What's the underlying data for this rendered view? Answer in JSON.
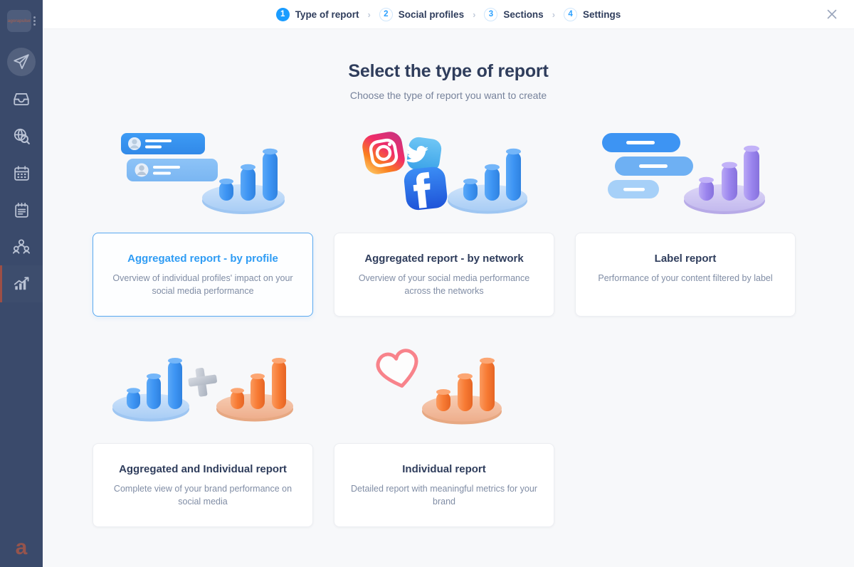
{
  "sidebar": {
    "logo_text": "agorapulse",
    "menu_icon": "kebab-menu-icon",
    "items": [
      {
        "icon": "paper-plane-icon",
        "name": "publishing"
      },
      {
        "icon": "inbox-tray-icon",
        "name": "inbox"
      },
      {
        "icon": "globe-search-icon",
        "name": "listening"
      },
      {
        "icon": "calendar-icon",
        "name": "calendar"
      },
      {
        "icon": "notepad-icon",
        "name": "content-library"
      },
      {
        "icon": "people-icon",
        "name": "fans-followers"
      },
      {
        "icon": "bar-chart-icon",
        "name": "reports"
      }
    ],
    "avatar_letter": "a"
  },
  "header": {
    "steps": [
      {
        "num": "1",
        "label": "Type of report",
        "active": true
      },
      {
        "num": "2",
        "label": "Social profiles",
        "active": false
      },
      {
        "num": "3",
        "label": "Sections",
        "active": false
      },
      {
        "num": "4",
        "label": "Settings",
        "active": false
      }
    ],
    "separator": "›",
    "close_label": "×"
  },
  "main": {
    "title": "Select the type of report",
    "subtitle": "Choose the type of report you want to create",
    "cards": [
      {
        "title": "Aggregated report - by profile",
        "desc": "Overview of individual profiles' impact on your social media performance",
        "selected": true,
        "illustration": "profiles-bars-illustration"
      },
      {
        "title": "Aggregated report - by network",
        "desc": "Overview of your social media performance across the networks",
        "selected": false,
        "illustration": "social-networks-bars-illustration"
      },
      {
        "title": "Label report",
        "desc": "Performance of your content filtered by label",
        "selected": false,
        "illustration": "labels-purple-bars-illustration"
      },
      {
        "title": "Aggregated and Individual report",
        "desc": "Complete view of your brand performance on social media",
        "selected": false,
        "illustration": "blue-plus-orange-bars-illustration"
      },
      {
        "title": "Individual report",
        "desc": "Detailed report with meaningful metrics for your brand",
        "selected": false,
        "illustration": "heart-orange-bars-illustration"
      }
    ]
  },
  "colors": {
    "sidebar_bg": "#3a4a6b",
    "accent_blue": "#2f9cf4",
    "step_active": "#1a9cff",
    "title_navy": "#2f3d5c",
    "muted_text": "#808da5",
    "page_bg": "#f7f8fa",
    "active_indicator": "#9d4f46"
  }
}
